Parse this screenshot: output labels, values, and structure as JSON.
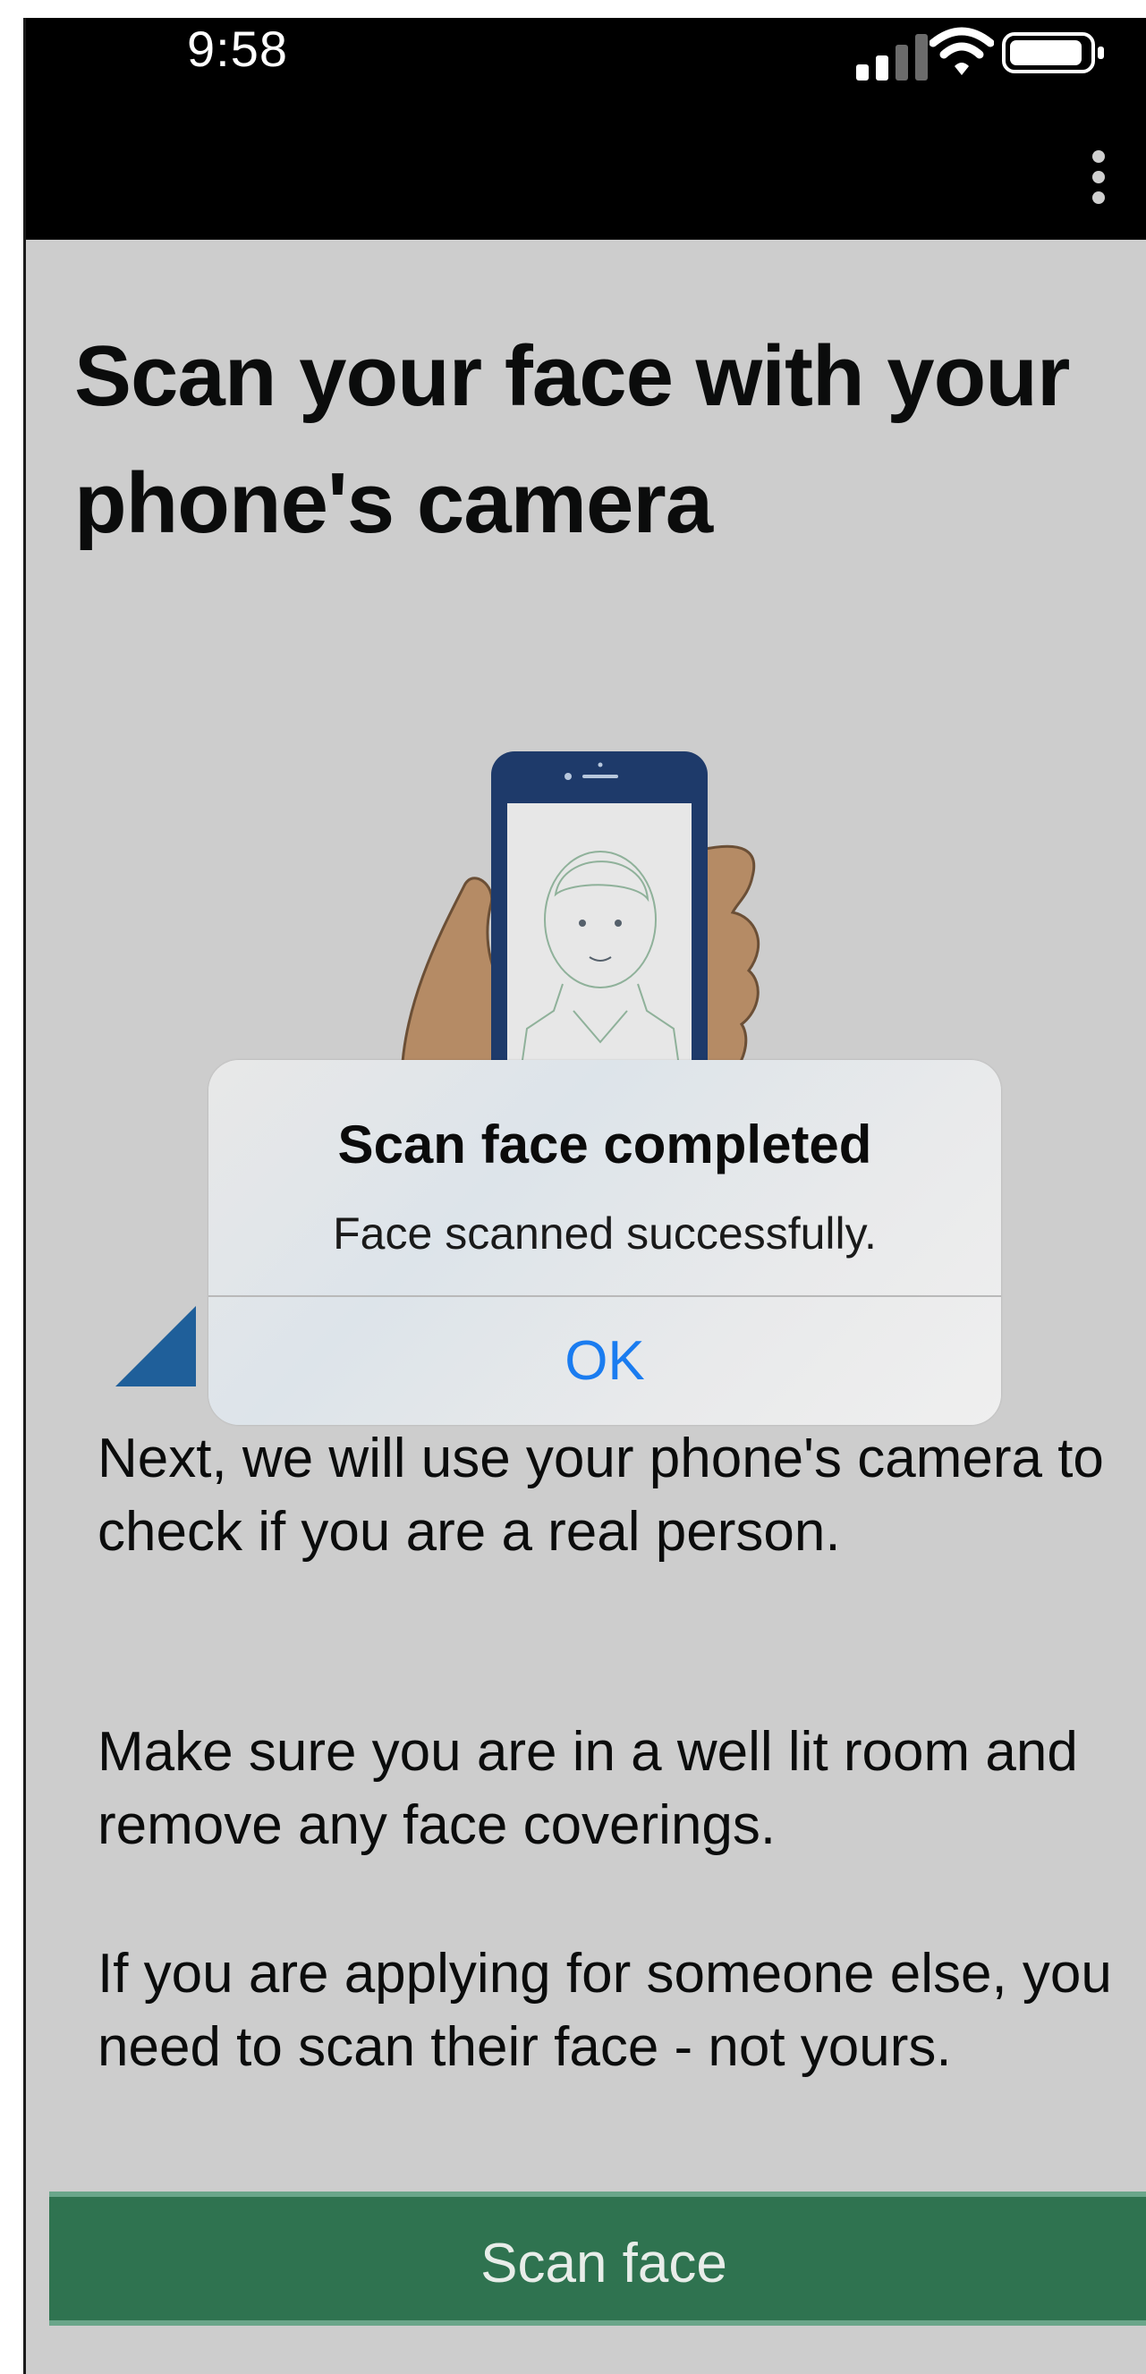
{
  "status_bar": {
    "time": "9:58",
    "icons": [
      "signal-icon",
      "wifi-icon",
      "battery-icon"
    ]
  },
  "app_bar": {
    "menu_icon": "more-vertical-icon"
  },
  "page": {
    "title": "Scan your face with your phone's camera",
    "illustration": "hand-holding-phone-face-scan-illustration",
    "paragraphs": [
      "Next, we will use your phone's camera to check if you are a real person.",
      "Make sure you are in a well lit room and remove any face coverings.",
      "If you are applying for someone else, you need to scan their face - not yours."
    ],
    "primary_button": "Scan face"
  },
  "alert": {
    "title": "Scan face completed",
    "message": "Face scanned successfully.",
    "ok_label": "OK"
  },
  "colors": {
    "background": "#cdcdcd",
    "button": "#2f7350",
    "link_blue": "#1a7cf0",
    "phone_navy": "#1e3a6a",
    "triangle_blue": "#1f5f9a"
  }
}
